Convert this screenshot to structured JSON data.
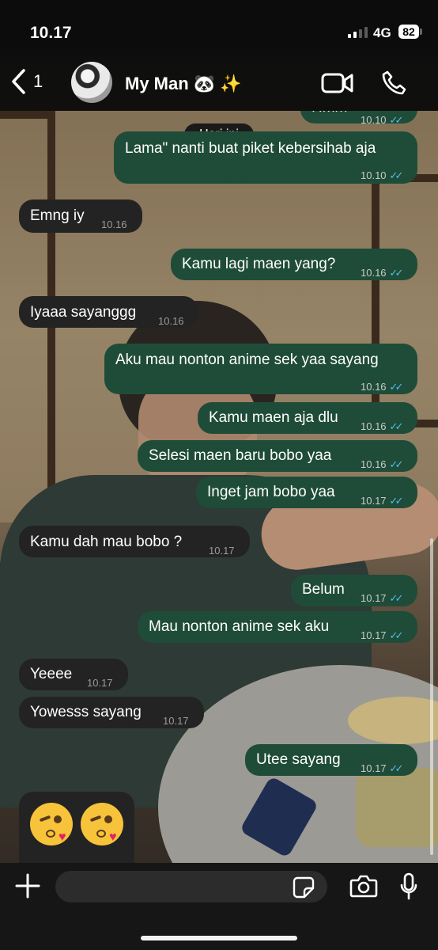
{
  "status": {
    "time": "10.17",
    "network": "4G",
    "battery": "82"
  },
  "header": {
    "back_count": "1",
    "contact_name": "My Man 🐼 ✨"
  },
  "chat": {
    "date_label": "Hari ini",
    "messages": [
      {
        "dir": "out",
        "text": "Hmm",
        "time": "10.10"
      },
      {
        "dir": "out",
        "text": "Lama\" nanti buat piket kebersihab aja",
        "time": "10.10"
      },
      {
        "dir": "in",
        "text": "Emng iy",
        "time": "10.16"
      },
      {
        "dir": "out",
        "text": "Kamu lagi maen yang?",
        "time": "10.16"
      },
      {
        "dir": "in",
        "text": "Iyaaa sayanggg",
        "time": "10.16"
      },
      {
        "dir": "out",
        "text": "Aku mau nonton anime sek yaa sayang",
        "time": "10.16"
      },
      {
        "dir": "out",
        "text": "Kamu maen aja dlu",
        "time": "10.16"
      },
      {
        "dir": "out",
        "text": "Selesi maen baru bobo yaa",
        "time": "10.16"
      },
      {
        "dir": "out",
        "text": "Inget jam bobo yaa",
        "time": "10.17"
      },
      {
        "dir": "in",
        "text": "Kamu dah mau bobo ?",
        "time": "10.17"
      },
      {
        "dir": "out",
        "text": "Belum",
        "time": "10.17"
      },
      {
        "dir": "out",
        "text": "Mau nonton anime sek aku",
        "time": "10.17"
      },
      {
        "dir": "in",
        "text": "Yeeee",
        "time": "10.17"
      },
      {
        "dir": "in",
        "text": "Yowesss sayang",
        "time": "10.17"
      },
      {
        "dir": "out",
        "text": "Utee sayang",
        "time": "10.17"
      }
    ],
    "emoji_message": {
      "emoji": [
        "face-blowing-a-kiss",
        "face-blowing-a-kiss"
      ]
    }
  },
  "colors": {
    "outgoing_bubble": "#1f4c38",
    "incoming_bubble": "#232323",
    "read_ticks": "#53bdeb"
  }
}
